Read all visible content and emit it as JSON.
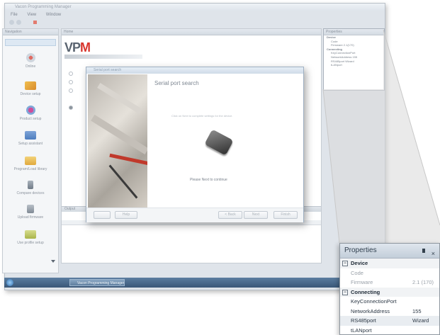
{
  "app": {
    "title": "Vacon Programming Manager",
    "menu": [
      "File",
      "View",
      "Window"
    ],
    "logo": "VPM",
    "status_text": "",
    "taskbar_item": "Vacon Programming Manager"
  },
  "sidebar": {
    "header": "Navigation",
    "items": [
      {
        "label": "Online",
        "icon": "online-icon",
        "color": "#d8463f"
      },
      {
        "label": "Device setup",
        "icon": "device-setup-icon",
        "color": "#e0a030"
      },
      {
        "label": "Product setup",
        "icon": "product-setup-icon",
        "color": "#c0398c"
      },
      {
        "label": "Setup assistant",
        "icon": "setup-assistant-icon",
        "color": "#4d7dbf"
      },
      {
        "label": "Program/Load library",
        "icon": "library-icon",
        "color": "#e8b74a"
      },
      {
        "label": "Compare devices",
        "icon": "compare-icon",
        "color": "#7b8794"
      },
      {
        "label": "Upload firmware",
        "icon": "firmware-icon",
        "color": "#7b8794"
      },
      {
        "label": "Use profile setup",
        "icon": "profile-icon",
        "color": "#a9b44a"
      }
    ]
  },
  "main": {
    "tab": "Home",
    "bottom_tab": "Output"
  },
  "dialog": {
    "title": "Serial port search",
    "heading": "Serial port search",
    "hint": "Click on Next to complete settings for the device.",
    "message": "Please Next to continue",
    "buttons": {
      "help": "Help",
      "back": "< Back",
      "next": "Next",
      "finish": "Finish"
    }
  },
  "properties_small": {
    "header": "Properties",
    "rows": [
      "Device",
      "Code",
      "Firmware  2.1(170)",
      "Connecting",
      "KeyConnectionPort",
      "NetworkAddress  155",
      "RS485port  Wizard",
      "tLANport"
    ]
  },
  "properties": {
    "header": "Properties",
    "pin_icon": "pin-icon",
    "close_icon": "close-icon",
    "device": {
      "category": "Device",
      "code_label": "Code",
      "firmware_label": "Firmware",
      "firmware_value": "2.1 (170)"
    },
    "connecting": {
      "category": "Connecting",
      "key_port_label": "KeyConnectionPort",
      "network_label": "NetworkAddress",
      "network_value": "155",
      "rs485_label": "RS485port",
      "rs485_value": "Wizard",
      "lan_label": "tLANport"
    }
  }
}
